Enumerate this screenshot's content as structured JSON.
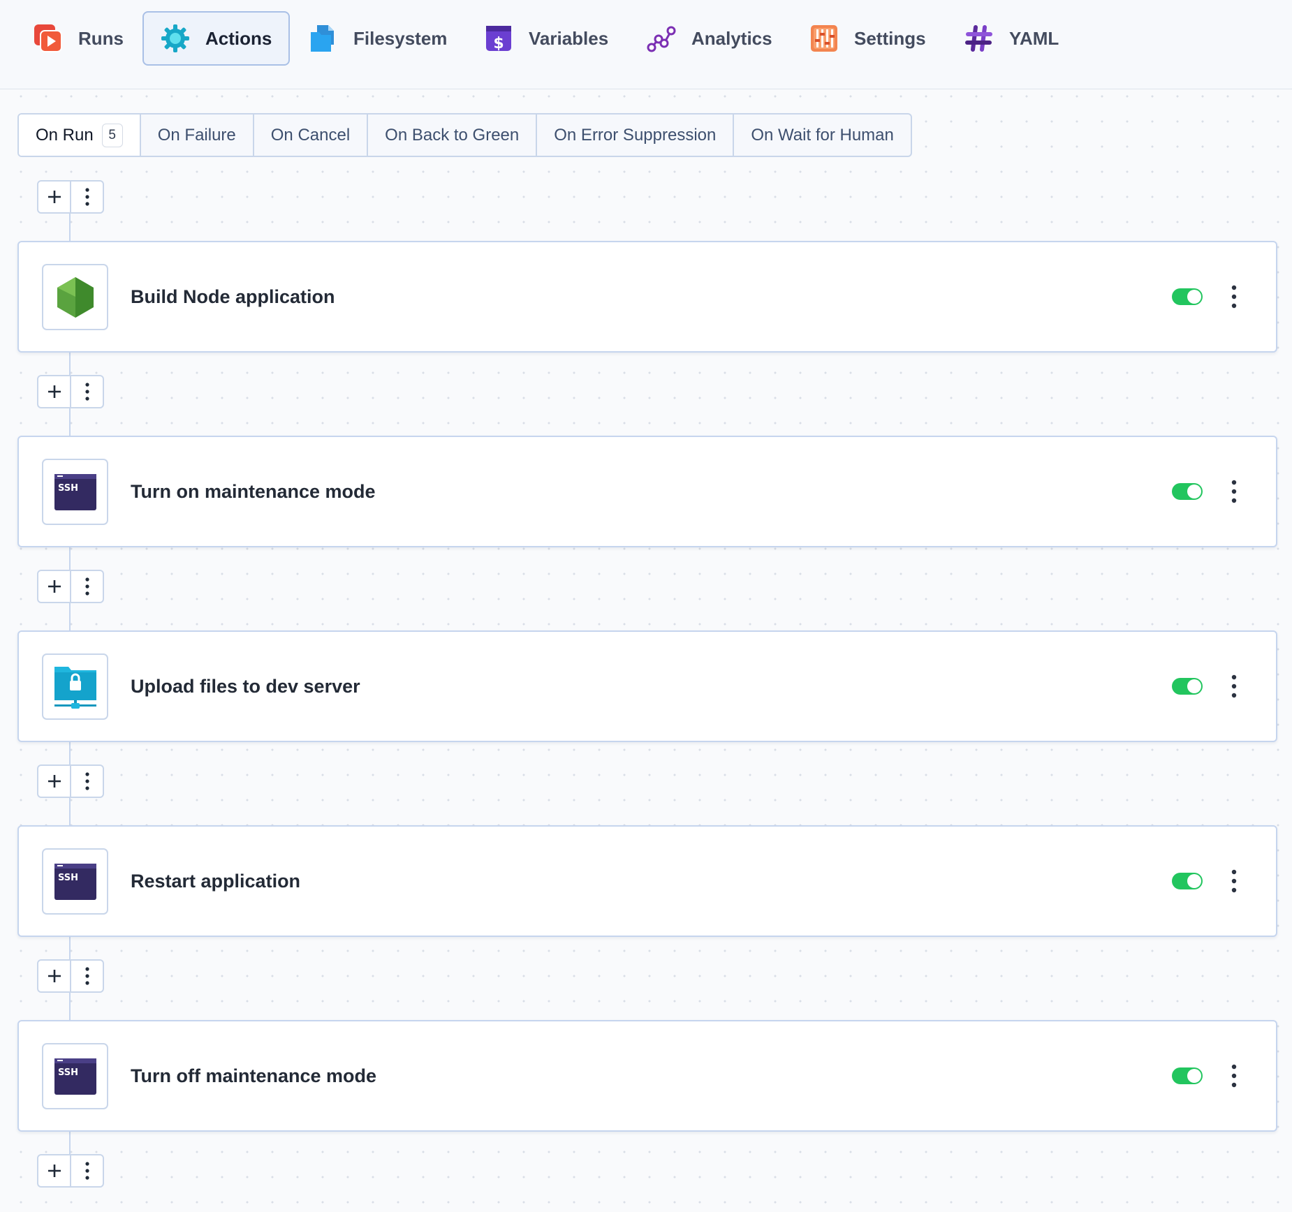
{
  "nav": {
    "tabs": [
      {
        "label": "Runs",
        "icon": "runs-play-icon"
      },
      {
        "label": "Actions",
        "icon": "actions-gear-icon",
        "active": true
      },
      {
        "label": "Filesystem",
        "icon": "filesystem-files-icon"
      },
      {
        "label": "Variables",
        "icon": "variables-dollar-icon"
      },
      {
        "label": "Analytics",
        "icon": "analytics-graph-icon"
      },
      {
        "label": "Settings",
        "icon": "settings-sliders-icon"
      },
      {
        "label": "YAML",
        "icon": "yaml-hash-icon"
      }
    ]
  },
  "subtabs": [
    {
      "label": "On Run",
      "count": "5",
      "active": true
    },
    {
      "label": "On Failure"
    },
    {
      "label": "On Cancel"
    },
    {
      "label": "On Back to Green"
    },
    {
      "label": "On Error Suppression"
    },
    {
      "label": "On Wait for Human"
    }
  ],
  "actions": [
    {
      "title": "Build Node application",
      "icon": "nodejs-hexagon-icon",
      "enabled": true
    },
    {
      "title": "Turn on maintenance mode",
      "icon": "ssh-terminal-icon",
      "enabled": true,
      "icon_text": "SSH"
    },
    {
      "title": "Upload files to dev server",
      "icon": "sftp-folder-lock-icon",
      "enabled": true
    },
    {
      "title": "Restart application",
      "icon": "ssh-terminal-icon",
      "enabled": true,
      "icon_text": "SSH"
    },
    {
      "title": "Turn off maintenance mode",
      "icon": "ssh-terminal-icon",
      "enabled": true,
      "icon_text": "SSH"
    }
  ],
  "colors": {
    "toggle_on": "#22c55e",
    "accent_border": "#a9c0e6",
    "card_border": "#c6d5ee"
  }
}
